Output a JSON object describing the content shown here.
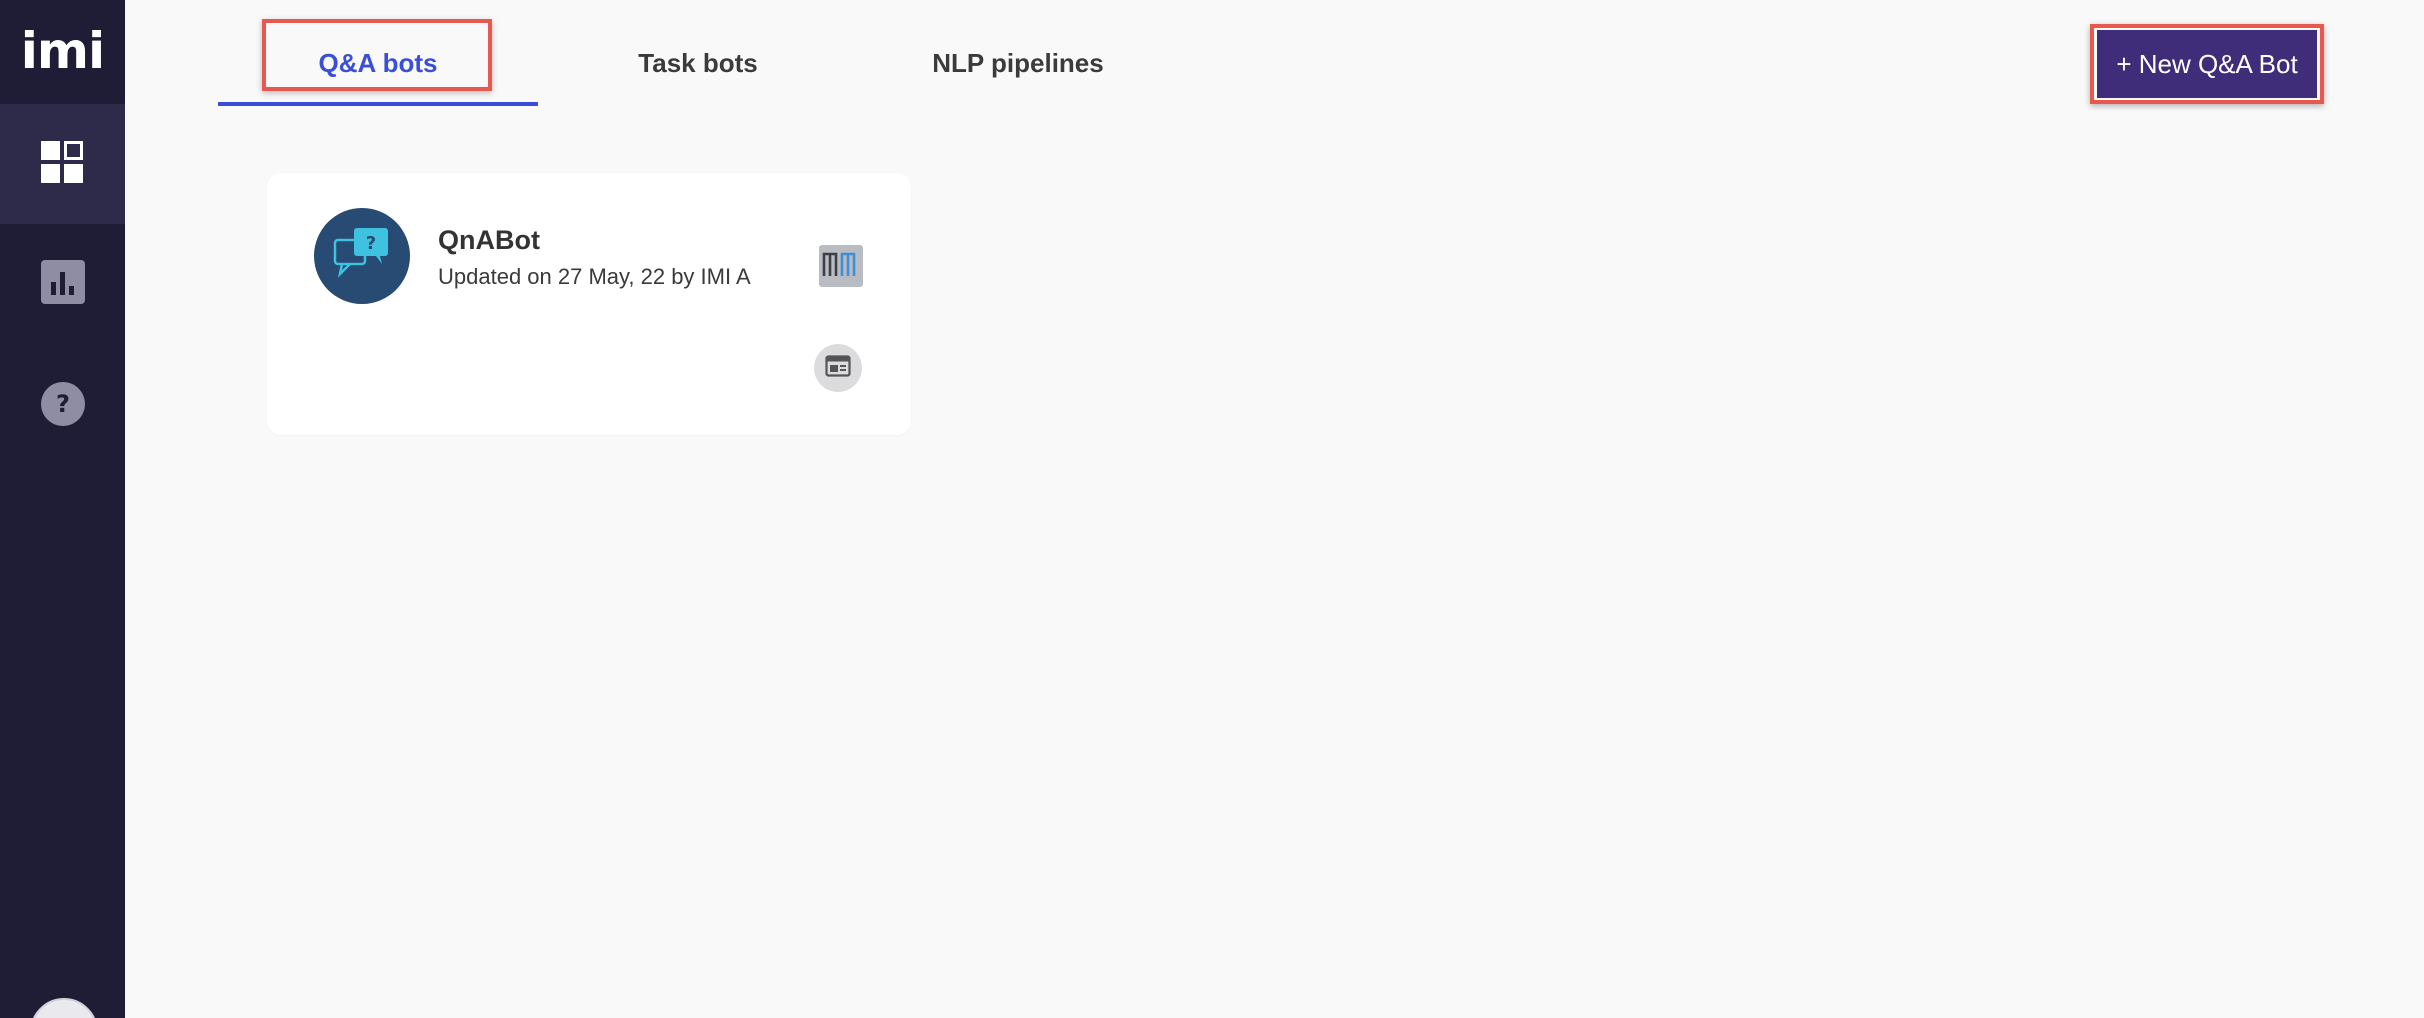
{
  "brand": {
    "logo_text": "imi"
  },
  "sidebar": {
    "items": [
      {
        "icon": "dashboard-icon",
        "active": true
      },
      {
        "icon": "analytics-icon",
        "active": false
      },
      {
        "icon": "help-icon",
        "glyph": "?",
        "active": false
      }
    ]
  },
  "tabs": [
    {
      "label": "Q&A bots",
      "active": true
    },
    {
      "label": "Task bots",
      "active": false
    },
    {
      "label": "NLP pipelines",
      "active": false
    }
  ],
  "actions": {
    "new_bot_label": "+ New Q&A Bot"
  },
  "bots": [
    {
      "name": "QnABot",
      "updated": "Updated on 27 May, 22 by IMI A",
      "avatar_icon": "qna-chat-icon",
      "avatar_glyph": "?",
      "engine_badge_icon": "mm-logo-icon",
      "channel_icon": "web-widget-icon"
    }
  ],
  "colors": {
    "sidebar_bg": "#1f1c35",
    "sidebar_active_bg": "#2e2b4a",
    "accent": "#3a4ed8",
    "button_bg": "#3f2d7a",
    "highlight_outline": "#e8584f",
    "bot_avatar_bg": "#274b72"
  }
}
